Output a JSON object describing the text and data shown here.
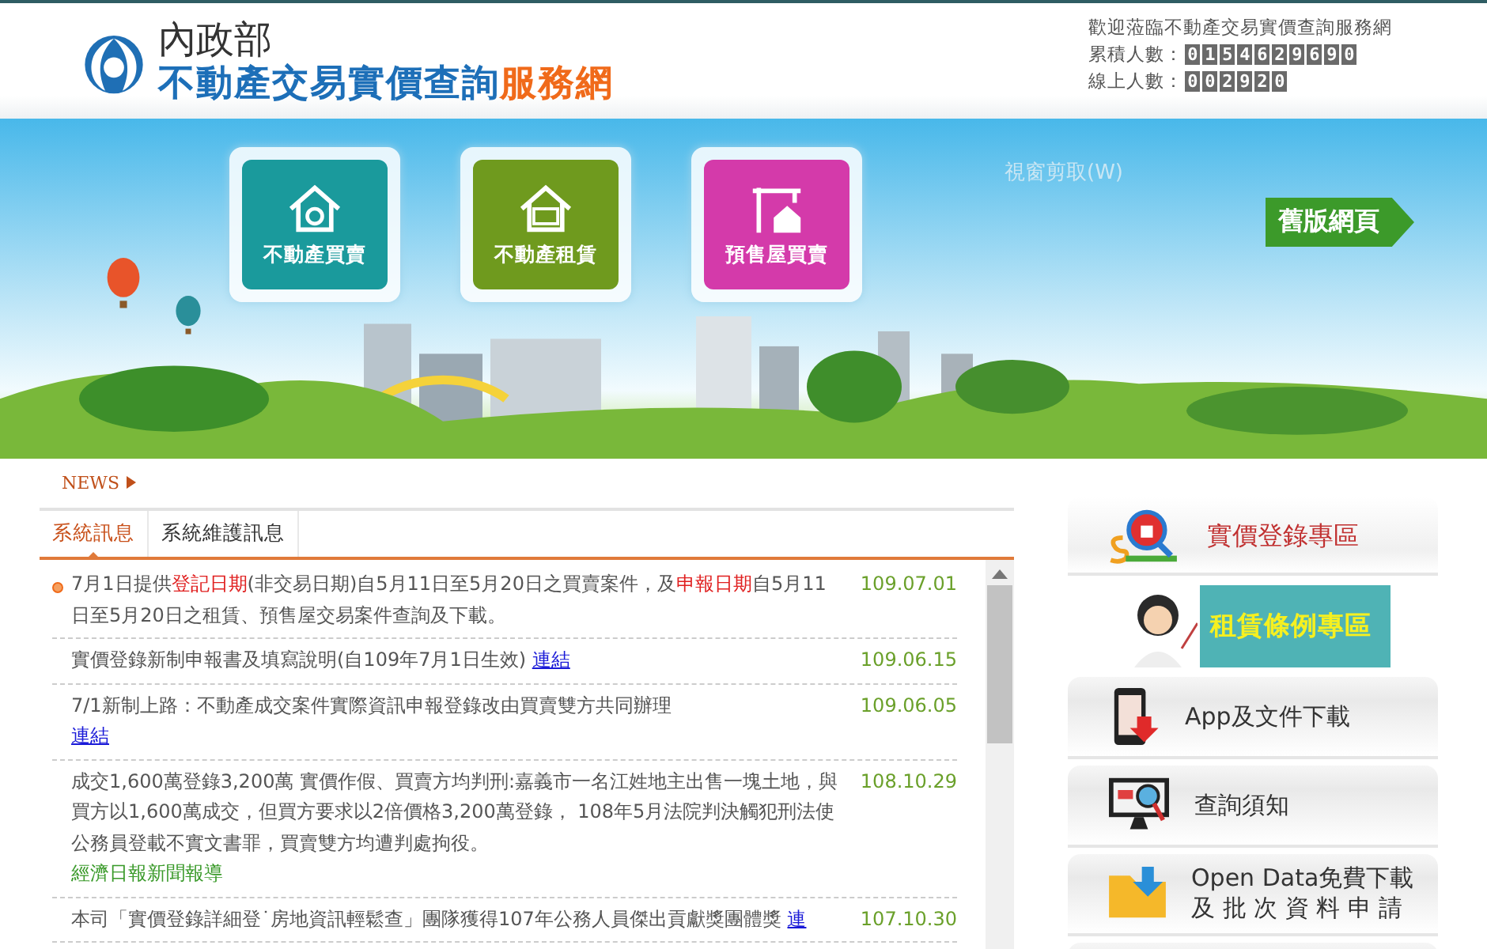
{
  "header": {
    "ministry": "內政部",
    "site_title": "不動產交易實價查詢",
    "site_title_accent": "服務網",
    "welcome": "歡迎蒞臨不動產交易實價查詢服務網",
    "counters": [
      {
        "label": "累積人數：",
        "value": "0154629690"
      },
      {
        "label": "線上人數：",
        "value": "002920"
      }
    ]
  },
  "banner": {
    "tiles": [
      {
        "label": "不動產買賣",
        "color": "#1a9a9c"
      },
      {
        "label": "不動產租賃",
        "color": "#6f9a1e"
      },
      {
        "label": "預售屋買賣",
        "color": "#d43aaa"
      }
    ],
    "overlay_text": "視窗剪取(W)",
    "old_site_button": "舊版網頁"
  },
  "news": {
    "heading": "NEWS",
    "tabs": [
      {
        "label": "系統訊息",
        "selected": true
      },
      {
        "label": "系統維護訊息",
        "selected": false
      }
    ],
    "items": [
      {
        "new": true,
        "date": "109.07.01",
        "segments": [
          {
            "text": "7月1日提供",
            "highlight": false
          },
          {
            "text": "登記日期",
            "highlight": true
          },
          {
            "text": "(非交易日期)自5月11日至5月20日之買賣案件，及",
            "highlight": false
          },
          {
            "text": "申報日期",
            "highlight": true
          },
          {
            "text": "自5月11日至5月20日之租賃、預售屋交易案件查詢及下載。",
            "highlight": false
          }
        ]
      },
      {
        "new": false,
        "date": "109.06.15",
        "segments": [
          {
            "text": "實價登錄新制申報書及填寫說明(自109年7月1日生效)",
            "highlight": false
          }
        ],
        "link": "連結"
      },
      {
        "new": false,
        "date": "109.06.05",
        "segments": [
          {
            "text": "7/1新制上路：不動產成交案件實際資訊申報登錄改由買賣雙方共同辦理",
            "highlight": false
          }
        ],
        "link": "連結",
        "link_on_new_line": true
      },
      {
        "new": false,
        "date": "108.10.29",
        "segments": [
          {
            "text": "成交1,600萬登錄3,200萬 實價作假、買賣方均判刑:嘉義市一名江姓地主出售一塊土地，與買方以1,600萬成交，但買方要求以2倍價格3,200萬登錄， 108年5月法院判決觸犯刑法使公務員登載不實文書罪，買賣雙方均遭判處拘役。",
            "highlight": false
          }
        ],
        "source": "經濟日報新聞報導"
      },
      {
        "new": false,
        "date": "107.10.30",
        "segments": [
          {
            "text": "本司「實價登錄詳細登˙房地資訊輕鬆查」團隊獲得107年公務人員傑出貢獻獎團體獎",
            "highlight": false
          }
        ],
        "link": "連"
      }
    ]
  },
  "sidebar": {
    "items": [
      {
        "kind": "feature",
        "label": "實價登錄專區"
      },
      {
        "kind": "promo",
        "label": "租賃條例專區"
      },
      {
        "kind": "button",
        "label": "App及文件下載"
      },
      {
        "kind": "button",
        "label": "查詢須知"
      },
      {
        "kind": "button",
        "label": "Open Data免費下載",
        "label_line2": "及 批 次 資 料 申 請"
      },
      {
        "kind": "button"
      }
    ]
  }
}
